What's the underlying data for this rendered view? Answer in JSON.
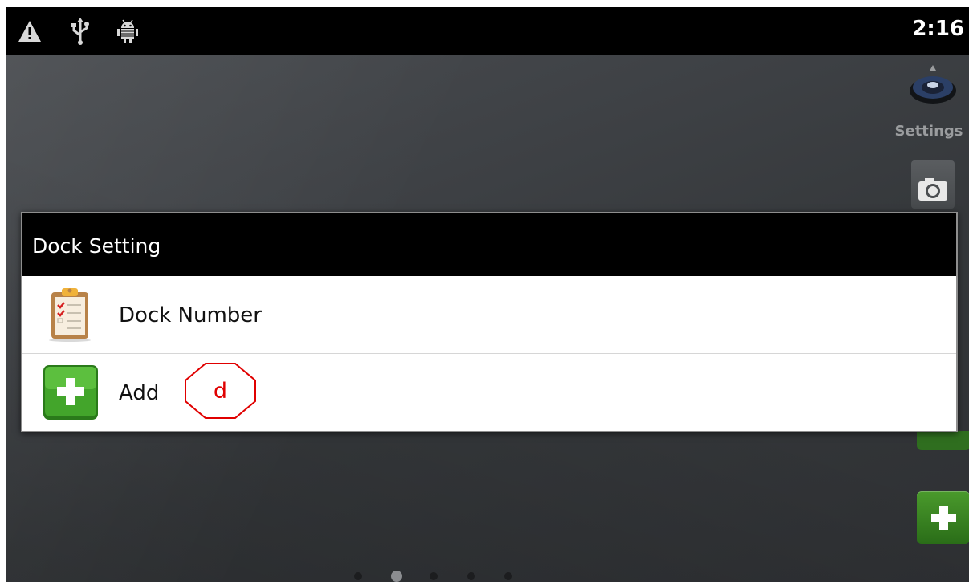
{
  "status_bar": {
    "time": "2:16",
    "icons": [
      "warning-icon",
      "usb-icon",
      "android-debug-icon"
    ]
  },
  "dock": {
    "settings_label": "Settings",
    "items": [
      "settings-icon",
      "camera-icon",
      "add-icon",
      "add-icon"
    ]
  },
  "dialog": {
    "title": "Dock Setting",
    "items": [
      {
        "label": "Dock Number",
        "icon": "clipboard-checklist-icon"
      },
      {
        "label": "Add",
        "icon": "green-plus-icon"
      }
    ]
  },
  "annotation": {
    "label": "d",
    "color": "#e00000"
  },
  "home_pages": {
    "count": 5,
    "active_index": 1
  },
  "colors": {
    "status_bar": "#000000",
    "dialog_header": "#000000",
    "dialog_body": "#ffffff",
    "add_green": "#3a9a26"
  }
}
